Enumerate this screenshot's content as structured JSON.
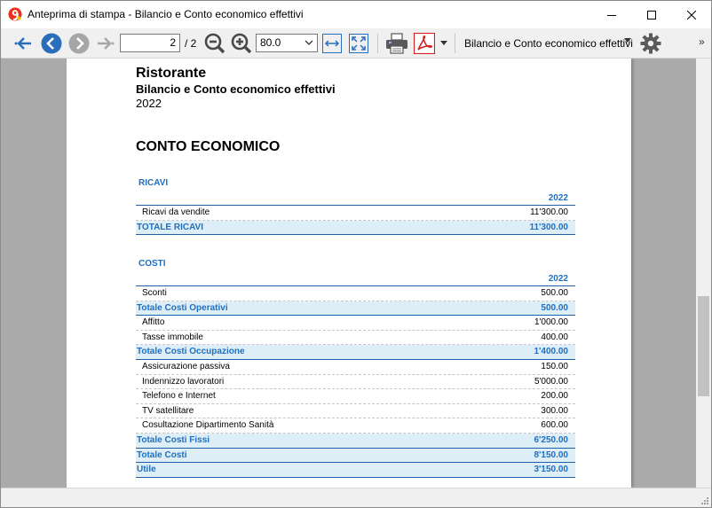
{
  "window": {
    "title": "Anteprima di stampa - Bilancio e Conto economico effettivi"
  },
  "toolbar": {
    "page_current": "2",
    "page_total": "/ 2",
    "zoom_value": "80.0",
    "report_name": "Bilancio e Conto economico effettivi"
  },
  "report": {
    "company": "Ristorante",
    "subtitle": "Bilancio e Conto economico effettivi",
    "year": "2022",
    "section_title": "CONTO ECONOMICO",
    "ricavi": {
      "label": "RICAVI",
      "year_col": "2022",
      "rows": [
        {
          "label": "Ricavi da vendite",
          "value": "11'300.00"
        },
        {
          "label": "TOTALE RICAVI",
          "value": "11'300.00",
          "total": true
        }
      ]
    },
    "costi": {
      "label": "COSTI",
      "year_col": "2022",
      "rows": [
        {
          "label": "Sconti",
          "value": "500.00"
        },
        {
          "label": "Totale Costi Operativi",
          "value": "500.00",
          "total": true
        },
        {
          "label": "Affitto",
          "value": "1'000.00"
        },
        {
          "label": "Tasse immobile",
          "value": "400.00"
        },
        {
          "label": "Totale Costi Occupazione",
          "value": "1'400.00",
          "total": true
        },
        {
          "label": "Assicurazione passiva",
          "value": "150.00"
        },
        {
          "label": "Indennizzo lavoratori",
          "value": "5'000.00"
        },
        {
          "label": "Telefono e Internet",
          "value": "200.00"
        },
        {
          "label": "TV satellitare",
          "value": "300.00"
        },
        {
          "label": "Cosultazione Dipartimento Sanità",
          "value": "600.00"
        },
        {
          "label": "Totale Costi Fissi",
          "value": "6'250.00",
          "total": true
        },
        {
          "label": "Totale Costi",
          "value": "8'150.00",
          "total": true
        },
        {
          "label": "Utile",
          "value": "3'150.00",
          "total": true
        }
      ]
    }
  },
  "colors": {
    "accent_blue": "#1f6fbf",
    "total_row_bg": "#deeef7",
    "pdf_red": "#d42020",
    "nav_blue": "#2a6ebb"
  },
  "icons": [
    "app-logo-icon",
    "first-page-icon",
    "prev-page-icon",
    "next-page-icon",
    "last-page-icon",
    "zoom-out-icon",
    "zoom-in-icon",
    "fit-width-icon",
    "fit-page-icon",
    "print-icon",
    "pdf-icon",
    "settings-icon",
    "minimize-icon",
    "maximize-icon",
    "close-icon"
  ]
}
